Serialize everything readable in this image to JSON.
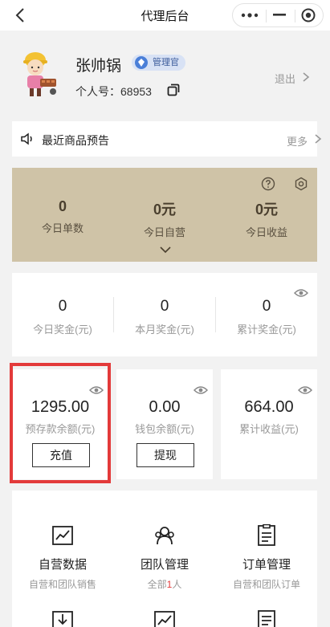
{
  "nav": {
    "title": "代理后台"
  },
  "profile": {
    "name": "张帅锅",
    "role": "管理官",
    "id_label": "个人号：",
    "id_value": "68953",
    "logout": "退出"
  },
  "notice": {
    "text": "最近商品预告",
    "more": "更多"
  },
  "stats": {
    "items": [
      {
        "value": "0",
        "label": "今日单数"
      },
      {
        "value": "0元",
        "label": "今日自营"
      },
      {
        "value": "0元",
        "label": "今日收益"
      }
    ]
  },
  "bonus": {
    "items": [
      {
        "value": "0",
        "label": "今日奖金(元)"
      },
      {
        "value": "0",
        "label": "本月奖金(元)"
      },
      {
        "value": "0",
        "label": "累计奖金(元)"
      }
    ]
  },
  "accounts": {
    "items": [
      {
        "value": "1295.00",
        "label": "预存款余额(元)",
        "action": "充值"
      },
      {
        "value": "0.00",
        "label": "钱包余额(元)",
        "action": "提现"
      },
      {
        "value": "664.00",
        "label": "累计收益(元)"
      }
    ]
  },
  "menu": {
    "items": [
      {
        "title": "自营数据",
        "sub": "自营和团队销售"
      },
      {
        "title": "团队管理",
        "sub_prefix": "全部",
        "sub_count": "1",
        "sub_suffix": "人"
      },
      {
        "title": "订单管理",
        "sub": "自营和团队订单"
      }
    ]
  },
  "colors": {
    "stats_bg": "#cfc3a7",
    "highlight": "#e33a3a",
    "badge_bg": "#d8e2f5"
  }
}
